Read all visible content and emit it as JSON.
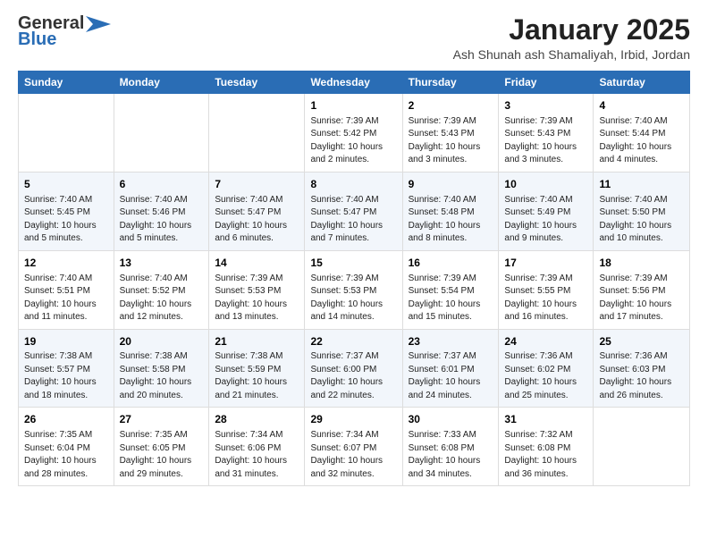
{
  "logo": {
    "line1": "General",
    "line2": "Blue"
  },
  "title": "January 2025",
  "subtitle": "Ash Shunah ash Shamaliyah, Irbid, Jordan",
  "days_of_week": [
    "Sunday",
    "Monday",
    "Tuesday",
    "Wednesday",
    "Thursday",
    "Friday",
    "Saturday"
  ],
  "weeks": [
    [
      {
        "day": "",
        "info": ""
      },
      {
        "day": "",
        "info": ""
      },
      {
        "day": "",
        "info": ""
      },
      {
        "day": "1",
        "info": "Sunrise: 7:39 AM\nSunset: 5:42 PM\nDaylight: 10 hours\nand 2 minutes."
      },
      {
        "day": "2",
        "info": "Sunrise: 7:39 AM\nSunset: 5:43 PM\nDaylight: 10 hours\nand 3 minutes."
      },
      {
        "day": "3",
        "info": "Sunrise: 7:39 AM\nSunset: 5:43 PM\nDaylight: 10 hours\nand 3 minutes."
      },
      {
        "day": "4",
        "info": "Sunrise: 7:40 AM\nSunset: 5:44 PM\nDaylight: 10 hours\nand 4 minutes."
      }
    ],
    [
      {
        "day": "5",
        "info": "Sunrise: 7:40 AM\nSunset: 5:45 PM\nDaylight: 10 hours\nand 5 minutes."
      },
      {
        "day": "6",
        "info": "Sunrise: 7:40 AM\nSunset: 5:46 PM\nDaylight: 10 hours\nand 5 minutes."
      },
      {
        "day": "7",
        "info": "Sunrise: 7:40 AM\nSunset: 5:47 PM\nDaylight: 10 hours\nand 6 minutes."
      },
      {
        "day": "8",
        "info": "Sunrise: 7:40 AM\nSunset: 5:47 PM\nDaylight: 10 hours\nand 7 minutes."
      },
      {
        "day": "9",
        "info": "Sunrise: 7:40 AM\nSunset: 5:48 PM\nDaylight: 10 hours\nand 8 minutes."
      },
      {
        "day": "10",
        "info": "Sunrise: 7:40 AM\nSunset: 5:49 PM\nDaylight: 10 hours\nand 9 minutes."
      },
      {
        "day": "11",
        "info": "Sunrise: 7:40 AM\nSunset: 5:50 PM\nDaylight: 10 hours\nand 10 minutes."
      }
    ],
    [
      {
        "day": "12",
        "info": "Sunrise: 7:40 AM\nSunset: 5:51 PM\nDaylight: 10 hours\nand 11 minutes."
      },
      {
        "day": "13",
        "info": "Sunrise: 7:40 AM\nSunset: 5:52 PM\nDaylight: 10 hours\nand 12 minutes."
      },
      {
        "day": "14",
        "info": "Sunrise: 7:39 AM\nSunset: 5:53 PM\nDaylight: 10 hours\nand 13 minutes."
      },
      {
        "day": "15",
        "info": "Sunrise: 7:39 AM\nSunset: 5:53 PM\nDaylight: 10 hours\nand 14 minutes."
      },
      {
        "day": "16",
        "info": "Sunrise: 7:39 AM\nSunset: 5:54 PM\nDaylight: 10 hours\nand 15 minutes."
      },
      {
        "day": "17",
        "info": "Sunrise: 7:39 AM\nSunset: 5:55 PM\nDaylight: 10 hours\nand 16 minutes."
      },
      {
        "day": "18",
        "info": "Sunrise: 7:39 AM\nSunset: 5:56 PM\nDaylight: 10 hours\nand 17 minutes."
      }
    ],
    [
      {
        "day": "19",
        "info": "Sunrise: 7:38 AM\nSunset: 5:57 PM\nDaylight: 10 hours\nand 18 minutes."
      },
      {
        "day": "20",
        "info": "Sunrise: 7:38 AM\nSunset: 5:58 PM\nDaylight: 10 hours\nand 20 minutes."
      },
      {
        "day": "21",
        "info": "Sunrise: 7:38 AM\nSunset: 5:59 PM\nDaylight: 10 hours\nand 21 minutes."
      },
      {
        "day": "22",
        "info": "Sunrise: 7:37 AM\nSunset: 6:00 PM\nDaylight: 10 hours\nand 22 minutes."
      },
      {
        "day": "23",
        "info": "Sunrise: 7:37 AM\nSunset: 6:01 PM\nDaylight: 10 hours\nand 24 minutes."
      },
      {
        "day": "24",
        "info": "Sunrise: 7:36 AM\nSunset: 6:02 PM\nDaylight: 10 hours\nand 25 minutes."
      },
      {
        "day": "25",
        "info": "Sunrise: 7:36 AM\nSunset: 6:03 PM\nDaylight: 10 hours\nand 26 minutes."
      }
    ],
    [
      {
        "day": "26",
        "info": "Sunrise: 7:35 AM\nSunset: 6:04 PM\nDaylight: 10 hours\nand 28 minutes."
      },
      {
        "day": "27",
        "info": "Sunrise: 7:35 AM\nSunset: 6:05 PM\nDaylight: 10 hours\nand 29 minutes."
      },
      {
        "day": "28",
        "info": "Sunrise: 7:34 AM\nSunset: 6:06 PM\nDaylight: 10 hours\nand 31 minutes."
      },
      {
        "day": "29",
        "info": "Sunrise: 7:34 AM\nSunset: 6:07 PM\nDaylight: 10 hours\nand 32 minutes."
      },
      {
        "day": "30",
        "info": "Sunrise: 7:33 AM\nSunset: 6:08 PM\nDaylight: 10 hours\nand 34 minutes."
      },
      {
        "day": "31",
        "info": "Sunrise: 7:32 AM\nSunset: 6:08 PM\nDaylight: 10 hours\nand 36 minutes."
      },
      {
        "day": "",
        "info": ""
      }
    ]
  ]
}
